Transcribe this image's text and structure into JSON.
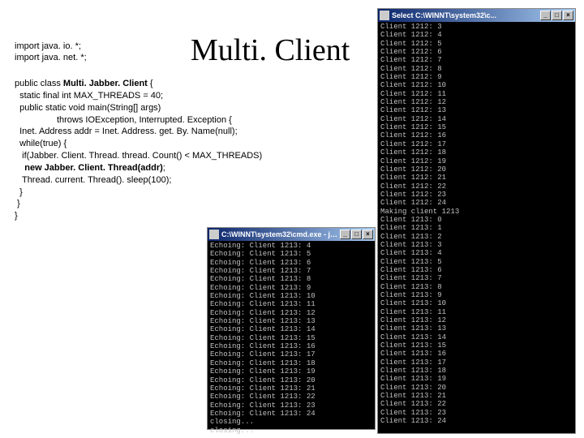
{
  "imports": [
    "import java. io. *;",
    "import java. net. *;"
  ],
  "title": "Multi. Client",
  "code_lines": [
    {
      "text": "public class ",
      "seg2": "Multi. Jabber. Client",
      "seg2_bold": true,
      "seg3": " {"
    },
    {
      "text": "  static final int MAX_THREADS = 40;"
    },
    {
      "text": "  public static void main(String[] args)"
    },
    {
      "text": "                 throws IOException, Interrupted. Exception {"
    },
    {
      "text": "  Inet. Address addr = Inet. Address. get. By. Name(null);"
    },
    {
      "text": "  while(true) {"
    },
    {
      "text": "   if(Jabber. Client. Thread. thread. Count() < MAX_THREADS)"
    },
    {
      "text": "    ",
      "seg2": "new Jabber. Client. Thread(addr)",
      "seg2_bold": true,
      "seg3": ";"
    },
    {
      "text": "   Thread. current. Thread(). sleep(100);"
    },
    {
      "text": "  }"
    },
    {
      "text": " }"
    },
    {
      "text": "}"
    }
  ],
  "console_right": {
    "title": "Select C:\\WINNT\\system32\\c...",
    "lines": [
      "Client 1212: 3",
      "Client 1212: 4",
      "Client 1212: 5",
      "Client 1212: 6",
      "Client 1212: 7",
      "Client 1212: 8",
      "Client 1212: 9",
      "Client 1212: 10",
      "Client 1212: 11",
      "Client 1212: 12",
      "Client 1212: 13",
      "Client 1212: 14",
      "Client 1212: 15",
      "Client 1212: 16",
      "Client 1212: 17",
      "Client 1212: 18",
      "Client 1212: 19",
      "Client 1212: 20",
      "Client 1212: 21",
      "Client 1212: 22",
      "Client 1212: 23",
      "Client 1212: 24",
      "Making client 1213",
      "Client 1213: 0",
      "Client 1213: 1",
      "Client 1213: 2",
      "Client 1213: 3",
      "Client 1213: 4",
      "Client 1213: 5",
      "Client 1213: 6",
      "Client 1213: 7",
      "Client 1213: 8",
      "Client 1213: 9",
      "Client 1213: 10",
      "Client 1213: 11",
      "Client 1213: 12",
      "Client 1213: 13",
      "Client 1213: 14",
      "Client 1213: 15",
      "Client 1213: 16",
      "Client 1213: 17",
      "Client 1213: 18",
      "Client 1213: 19",
      "Client 1213: 20",
      "Client 1213: 21",
      "Client 1213: 22",
      "Client 1213: 23",
      "Client 1213: 24"
    ]
  },
  "console_bottom": {
    "title": "C:\\WINNT\\system32\\cmd.exe - ja...",
    "lines": [
      "Echoing: Client 1213: 4",
      "Echoing: Client 1213: 5",
      "Echoing: Client 1213: 6",
      "Echoing: Client 1213: 7",
      "Echoing: Client 1213: 8",
      "Echoing: Client 1213: 9",
      "Echoing: Client 1213: 10",
      "Echoing: Client 1213: 11",
      "Echoing: Client 1213: 12",
      "Echoing: Client 1213: 13",
      "Echoing: Client 1213: 14",
      "Echoing: Client 1213: 15",
      "Echoing: Client 1213: 16",
      "Echoing: Client 1213: 17",
      "Echoing: Client 1213: 18",
      "Echoing: Client 1213: 19",
      "Echoing: Client 1213: 20",
      "Echoing: Client 1213: 21",
      "Echoing: Client 1213: 22",
      "Echoing: Client 1213: 23",
      "Echoing: Client 1213: 24",
      "closing...",
      "closing..."
    ]
  },
  "window_buttons": {
    "min": "_",
    "max": "□",
    "close": "×"
  }
}
